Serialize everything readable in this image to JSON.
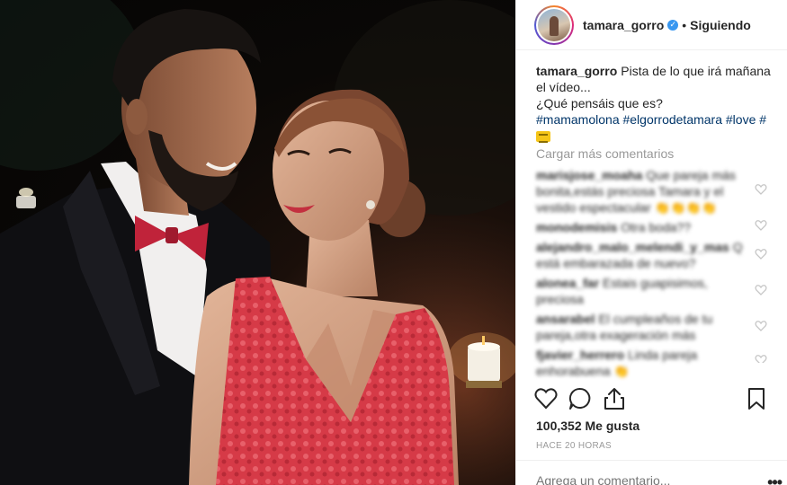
{
  "header": {
    "username": "tamara_gorro",
    "separator": "•",
    "follow_label": "Siguiendo"
  },
  "caption": {
    "username": "tamara_gorro",
    "line1": "Pista de lo que irá mañana el vídeo...",
    "line2": "¿Qué pensáis que es?",
    "hashtags": "#mamamolona #elgorrodetamara #love #"
  },
  "load_more_label": "Cargar más comentarios",
  "comments": [
    {
      "user": "marisjose_moaha",
      "text": "Que pareja más bonita,estás preciosa Tamara y el vestido espectacular 👏👏👏👏"
    },
    {
      "user": "monodemisis",
      "text": "Otra boda??"
    },
    {
      "user": "alejandro_malo_melendi_y_mas",
      "text": "Q está embarazada de nuevo?"
    },
    {
      "user": "alonea_far",
      "text": "Estais guapisimos, preciosa"
    },
    {
      "user": "ansarabel",
      "text": "El cumpleaños de tu pareja,otra exageración más"
    },
    {
      "user": "fjavier_herrero",
      "text": "Linda pareja enhorabuena 👏"
    }
  ],
  "likes": "100,352 Me gusta",
  "timestamp": "HACE 20 HORAS",
  "add_comment_placeholder": "Agrega un comentario...",
  "options_label": "•••",
  "icons": [
    "heart-icon",
    "comment-icon",
    "share-icon",
    "bookmark-icon",
    "verified-icon"
  ],
  "colors": {
    "link": "#003569",
    "muted": "#999999",
    "verified": "#3897f0",
    "dress": "#d9434f",
    "bowtie": "#c0233a"
  }
}
